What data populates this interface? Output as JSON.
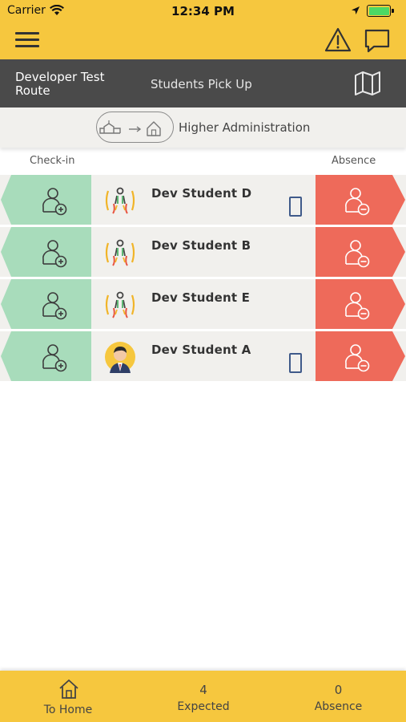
{
  "status_bar": {
    "carrier": "Carrier",
    "time": "12:34 PM"
  },
  "nav": {
    "menu_icon": "hamburger-icon",
    "alert_icon": "warning-icon",
    "chat_icon": "chat-bubble-icon"
  },
  "route": {
    "name": "Developer Test Route",
    "type": "Students Pick Up",
    "map_icon": "map-icon"
  },
  "destination": {
    "label": "Higher Administration",
    "icon": "school-to-home-icon"
  },
  "columns": {
    "checkin": "Check-in",
    "absence": "Absence"
  },
  "students": [
    {
      "name": "Dev Student D",
      "avatar": "kid-avatar",
      "has_phone": true
    },
    {
      "name": "Dev Student B",
      "avatar": "kid-avatar",
      "has_phone": false
    },
    {
      "name": "Dev Student E",
      "avatar": "kid-avatar",
      "has_phone": false
    },
    {
      "name": "Dev Student A",
      "avatar": "boy-photo-avatar",
      "has_phone": true
    }
  ],
  "tabs": {
    "home_label": "To Home",
    "expected_value": "4",
    "expected_label": "Expected",
    "absence_value": "0",
    "absence_label": "Absence"
  },
  "colors": {
    "brand_yellow": "#F6C73E",
    "checkin_green": "#A8DCBB",
    "absence_red": "#EE6A5A",
    "dark_bar": "#4A4A4A",
    "row_bg": "#F1F0ED"
  }
}
